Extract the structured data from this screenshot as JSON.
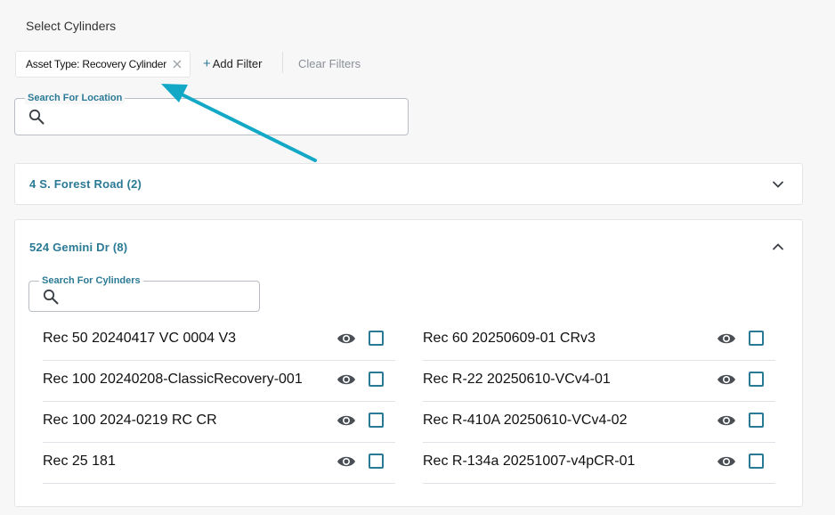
{
  "page": {
    "title": "Select Cylinders"
  },
  "filters": {
    "active_chip": "Asset Type: Recovery Cylinder",
    "add_filter_label": "Add Filter",
    "clear_filters_label": "Clear Filters"
  },
  "location_search": {
    "legend": "Search For Location",
    "value": "",
    "icon": "search-icon"
  },
  "locations": [
    {
      "title": "4 S. Forest Road (2)",
      "expanded": false
    },
    {
      "title": "524 Gemini Dr (8)",
      "expanded": true,
      "cylinder_search": {
        "legend": "Search For Cylinders",
        "value": ""
      },
      "cylinders_left": [
        {
          "name": "Rec 50 20240417 VC 0004 V3",
          "checked": false
        },
        {
          "name": "Rec 100 20240208-ClassicRecovery-001",
          "checked": false
        },
        {
          "name": "Rec 100 2024-0219 RC CR",
          "checked": false
        },
        {
          "name": "Rec 25 181",
          "checked": false
        }
      ],
      "cylinders_right": [
        {
          "name": "Rec 60 20250609-01 CRv3",
          "checked": false
        },
        {
          "name": "Rec R-22 20250610-VCv4-01",
          "checked": false
        },
        {
          "name": "Rec R-410A 20250610-VCv4-02",
          "checked": false
        },
        {
          "name": "Rec R-134a 20251007-v4pCR-01",
          "checked": false
        }
      ]
    }
  ],
  "colors": {
    "accent": "#2b7a95",
    "annotation_arrow": "#13a8c6",
    "background": "#f7f7f8"
  }
}
